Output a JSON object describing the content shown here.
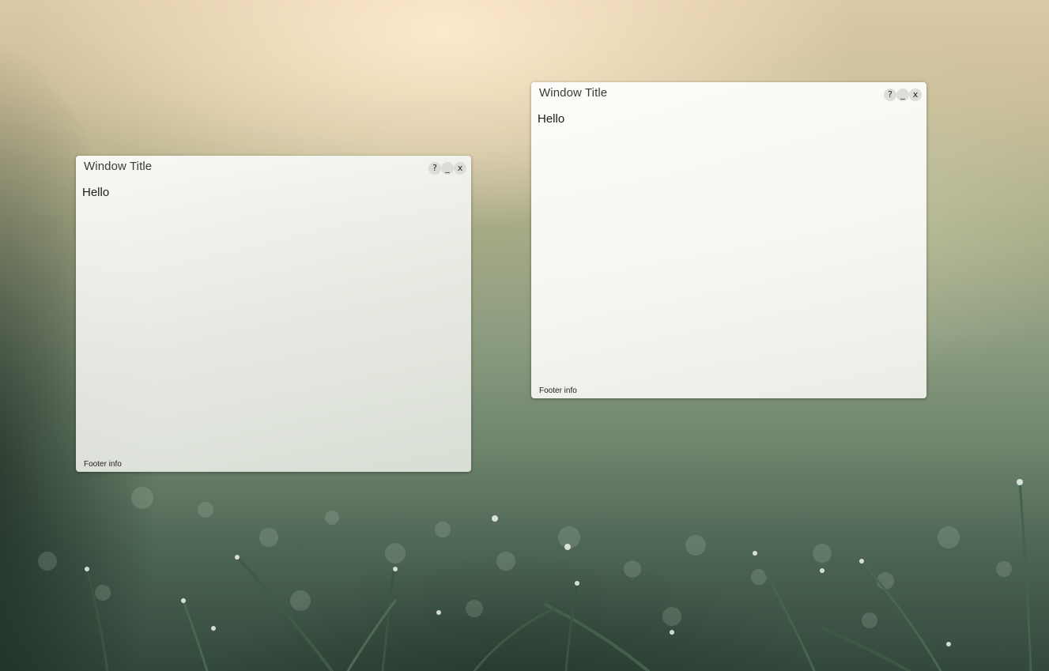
{
  "windows": [
    {
      "title": "Window Title",
      "controls": {
        "help": "?",
        "minimize": "_",
        "close": "x"
      },
      "content": "Hello",
      "footer": "Footer info"
    },
    {
      "title": "Window Title",
      "controls": {
        "help": "?",
        "minimize": "_",
        "close": "x"
      },
      "content": "Hello",
      "footer": "Footer info"
    }
  ],
  "wallpaper": {
    "subject": "dewy grass at dawn",
    "colors": {
      "sky": "#dcc9a6",
      "mid": "#8d9c80",
      "ground": "#33483c"
    }
  }
}
